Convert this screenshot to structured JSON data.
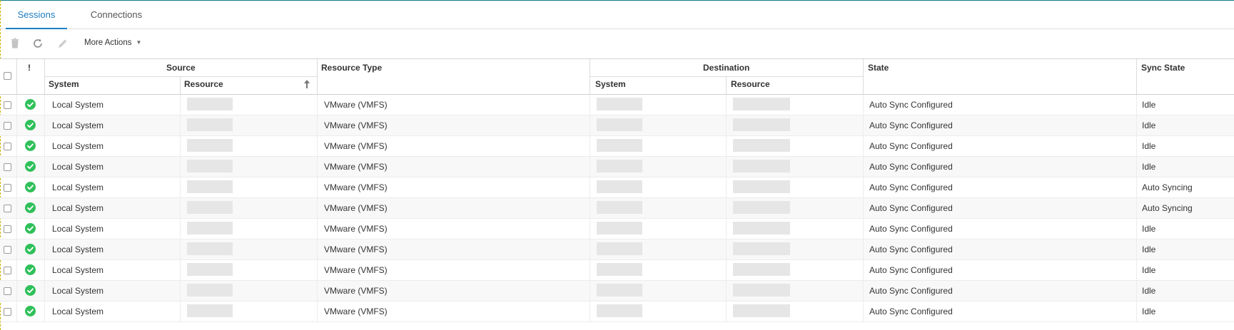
{
  "tabs": [
    {
      "label": "Sessions",
      "active": true
    },
    {
      "label": "Connections",
      "active": false
    }
  ],
  "toolbar": {
    "delete_icon": "trash-icon",
    "refresh_icon": "refresh-icon",
    "edit_icon": "pencil-icon",
    "more_actions_label": "More Actions"
  },
  "table": {
    "group_headers": {
      "indicator": "!",
      "source": "Source",
      "resource_type": "Resource Type",
      "destination": "Destination",
      "state": "State",
      "sync_state": "Sync State"
    },
    "sub_headers": {
      "source_system": "System",
      "source_resource": "Resource",
      "dest_system": "System",
      "dest_resource": "Resource"
    },
    "sort": {
      "column": "source_resource",
      "direction": "ascending"
    },
    "rows": [
      {
        "status_icon": "check-circle-icon",
        "source_system": "Local System",
        "resource_type": "VMware (VMFS)",
        "state": "Auto Sync Configured",
        "sync_state": "Idle"
      },
      {
        "status_icon": "check-circle-icon",
        "source_system": "Local System",
        "resource_type": "VMware (VMFS)",
        "state": "Auto Sync Configured",
        "sync_state": "Idle"
      },
      {
        "status_icon": "check-circle-icon",
        "source_system": "Local System",
        "resource_type": "VMware (VMFS)",
        "state": "Auto Sync Configured",
        "sync_state": "Idle"
      },
      {
        "status_icon": "check-circle-icon",
        "source_system": "Local System",
        "resource_type": "VMware (VMFS)",
        "state": "Auto Sync Configured",
        "sync_state": "Idle"
      },
      {
        "status_icon": "check-circle-icon",
        "source_system": "Local System",
        "resource_type": "VMware (VMFS)",
        "state": "Auto Sync Configured",
        "sync_state": "Auto Syncing"
      },
      {
        "status_icon": "check-circle-icon",
        "source_system": "Local System",
        "resource_type": "VMware (VMFS)",
        "state": "Auto Sync Configured",
        "sync_state": "Auto Syncing"
      },
      {
        "status_icon": "check-circle-icon",
        "source_system": "Local System",
        "resource_type": "VMware (VMFS)",
        "state": "Auto Sync Configured",
        "sync_state": "Idle"
      },
      {
        "status_icon": "check-circle-icon",
        "source_system": "Local System",
        "resource_type": "VMware (VMFS)",
        "state": "Auto Sync Configured",
        "sync_state": "Idle"
      },
      {
        "status_icon": "check-circle-icon",
        "source_system": "Local System",
        "resource_type": "VMware (VMFS)",
        "state": "Auto Sync Configured",
        "sync_state": "Idle"
      },
      {
        "status_icon": "check-circle-icon",
        "source_system": "Local System",
        "resource_type": "VMware (VMFS)",
        "state": "Auto Sync Configured",
        "sync_state": "Idle"
      },
      {
        "status_icon": "check-circle-icon",
        "source_system": "Local System",
        "resource_type": "VMware (VMFS)",
        "state": "Auto Sync Configured",
        "sync_state": "Idle"
      }
    ]
  },
  "colors": {
    "accent": "#1d7ec2",
    "status_ok": "#2fc05a"
  }
}
